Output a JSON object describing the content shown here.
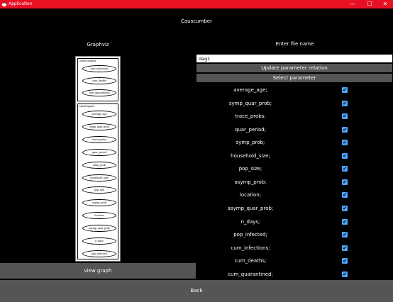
{
  "window": {
    "title": "Application",
    "minimize_glyph": "—",
    "maximize_glyph": "☐",
    "close_glyph": "✕",
    "accent_color": "#e81123"
  },
  "header": {
    "app_title": "Causcumber"
  },
  "left": {
    "graph_title": "Graphviz",
    "view_graph_label": "view graph",
    "graph": {
      "outputs_label": "Model outputs",
      "outputs": [
        "cum_infections",
        "cum_deaths",
        "cum_quarantined"
      ],
      "inputs_label": "Model inputs",
      "inputs": [
        "average_age",
        "symp_quar_prob",
        "trace_probs",
        "quar_period",
        "symp_prob",
        "household_size",
        "pop_size",
        "asymp_prob",
        "location",
        "asymp_quar_prob",
        "n_days",
        "pop_infected"
      ]
    }
  },
  "right": {
    "file_label": "Enter file name",
    "file_value": "dag1",
    "update_button": "Update parameter relation",
    "select_button": "Select parameter",
    "parameters": [
      {
        "label": "average_age;",
        "checked": true
      },
      {
        "label": "symp_quar_prob;",
        "checked": true
      },
      {
        "label": "trace_probs;",
        "checked": true
      },
      {
        "label": "quar_period;",
        "checked": true
      },
      {
        "label": "symp_prob;",
        "checked": true
      },
      {
        "label": "household_size;",
        "checked": true
      },
      {
        "label": "pop_size;",
        "checked": true
      },
      {
        "label": "asymp_prob;",
        "checked": true
      },
      {
        "label": "location;",
        "checked": true
      },
      {
        "label": "asymp_quar_prob;",
        "checked": true
      },
      {
        "label": "n_days;",
        "checked": true
      },
      {
        "label": "pop_infected;",
        "checked": true
      },
      {
        "label": "cum_infections;",
        "checked": true
      },
      {
        "label": "cum_deaths;",
        "checked": true
      },
      {
        "label": "cum_quarantined;",
        "checked": true
      }
    ],
    "check_glyph": "✔",
    "checkbox_color": "#4da3ff"
  },
  "footer": {
    "back_label": "Back"
  }
}
